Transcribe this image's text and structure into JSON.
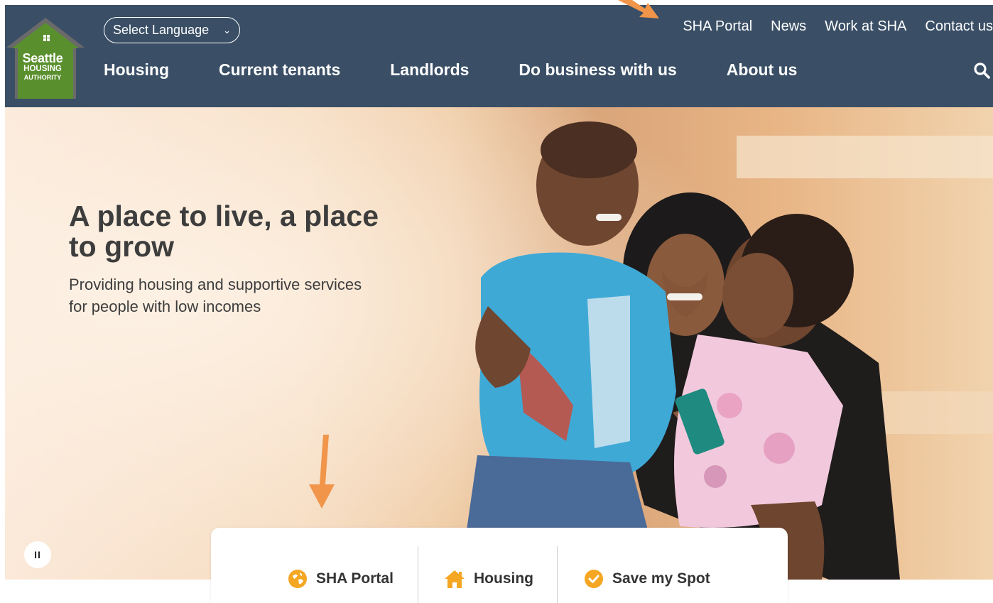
{
  "header": {
    "logo": {
      "line1": "Seattle",
      "line2": "HOUSING",
      "line3": "AUTHORITY",
      "color": "#5a8f2e"
    },
    "language_select": {
      "value": "Select Language"
    },
    "utility_nav": [
      "SHA Portal",
      "News",
      "Work at SHA",
      "Contact us"
    ],
    "main_nav": [
      "Housing",
      "Current tenants",
      "Landlords",
      "Do business with us",
      "About us"
    ],
    "background": "#3a4f66"
  },
  "hero": {
    "title": "A place to live, a place to grow",
    "subtitle": "Providing housing and supportive services for people with low incomes",
    "pause_label": "II"
  },
  "quick_links": [
    {
      "label": "SHA Portal",
      "icon": "globe-icon"
    },
    {
      "label": "Housing",
      "icon": "house-icon"
    },
    {
      "label": "Save my Spot",
      "icon": "check-circle-icon"
    }
  ],
  "colors": {
    "accent_orange": "#f5a623",
    "annotation_arrow": "#f0954a"
  }
}
